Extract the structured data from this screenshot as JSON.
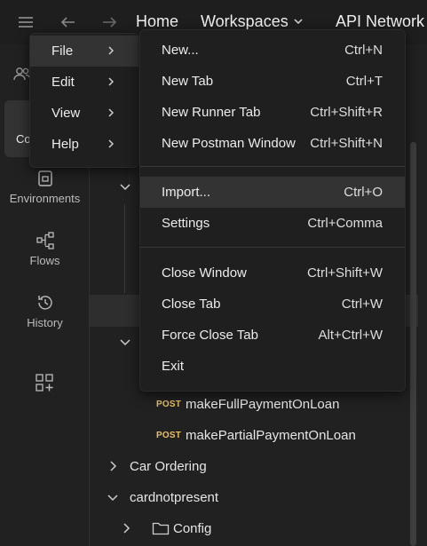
{
  "topbar": {
    "home": "Home",
    "workspaces": "Workspaces",
    "api_network": "API Network"
  },
  "rail": {
    "collections_partial": "Co",
    "environments": "Environments",
    "flows": "Flows",
    "history": "History"
  },
  "main_menu": {
    "items": [
      {
        "label": "File"
      },
      {
        "label": "Edit"
      },
      {
        "label": "View"
      },
      {
        "label": "Help"
      }
    ]
  },
  "file_menu": {
    "items": [
      {
        "label": "New...",
        "shortcut": "Ctrl+N"
      },
      {
        "label": "New Tab",
        "shortcut": "Ctrl+T"
      },
      {
        "label": "New Runner Tab",
        "shortcut": "Ctrl+Shift+R"
      },
      {
        "label": "New Postman Window",
        "shortcut": "Ctrl+Shift+N"
      },
      {
        "label": "Import...",
        "shortcut": "Ctrl+O"
      },
      {
        "label": "Settings",
        "shortcut": "Ctrl+Comma"
      },
      {
        "label": "Close Window",
        "shortcut": "Ctrl+Shift+W"
      },
      {
        "label": "Close Tab",
        "shortcut": "Ctrl+W"
      },
      {
        "label": "Force Close Tab",
        "shortcut": "Alt+Ctrl+W"
      },
      {
        "label": "Exit",
        "shortcut": ""
      }
    ]
  },
  "tree": {
    "requests": [
      {
        "method": "POST",
        "name": "makeFullPaymentOnLoan"
      },
      {
        "method": "POST",
        "name": "makePartialPaymentOnLoan"
      }
    ],
    "folders": [
      {
        "name": "Car Ordering"
      },
      {
        "name": "cardnotpresent"
      },
      {
        "name": "Config"
      }
    ]
  }
}
